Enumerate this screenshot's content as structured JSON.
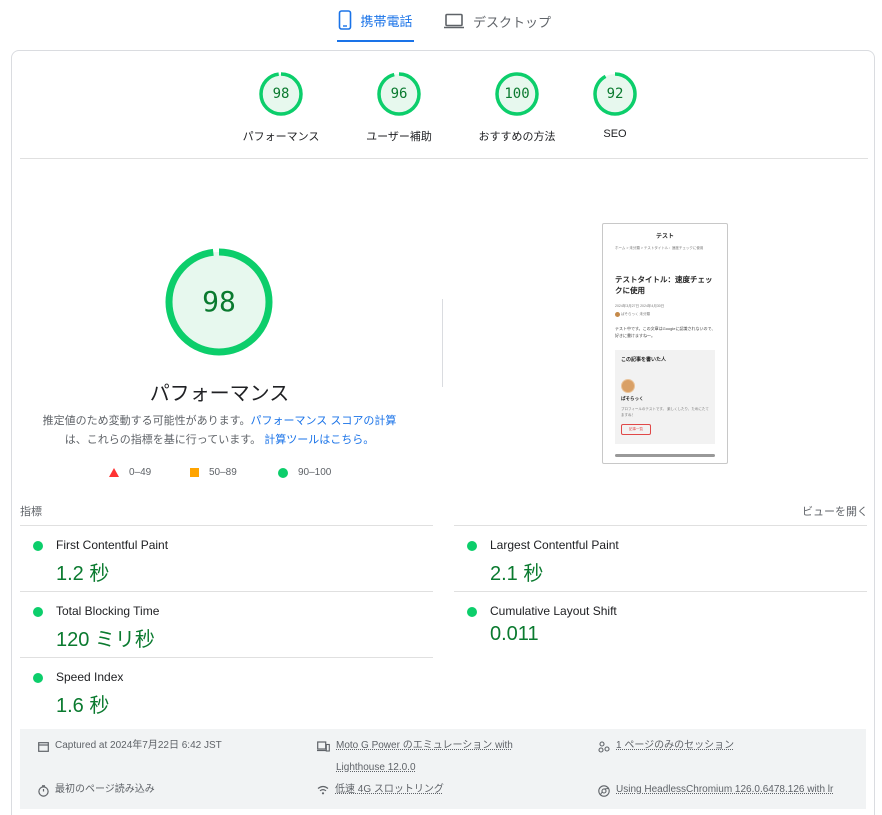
{
  "tabs": [
    {
      "label": "携帯電話",
      "icon": "smartphone-icon",
      "active": true
    },
    {
      "label": "デスクトップ",
      "icon": "laptop-icon",
      "active": false
    }
  ],
  "gauges": [
    {
      "score": "98",
      "label": "パフォーマンス"
    },
    {
      "score": "96",
      "label": "ユーザー補助"
    },
    {
      "score": "100",
      "label": "おすすめの方法"
    },
    {
      "score": "92",
      "label": "SEO"
    }
  ],
  "performance": {
    "score": "98",
    "title": "パフォーマンス",
    "desc_1": "推定値のため変動する可能性があります。",
    "link_1": "パフォーマンス スコアの計算",
    "desc_2": "は、これらの指標を基に行っています。",
    "link_2": "計算ツールはこちら。"
  },
  "legend": [
    {
      "range": "0–49",
      "color": "#ff3333",
      "shape": "triangle"
    },
    {
      "range": "50–89",
      "color": "#ffa400",
      "shape": "square"
    },
    {
      "range": "90–100",
      "color": "#0cce6b",
      "shape": "circle"
    }
  ],
  "screenshot": {
    "site_title": "テスト",
    "breadcrumb": "ホーム > 未分類 > テストタイトル：速度チェックに使用",
    "heading": "テストタイトル：速度チェックに使用",
    "meta": "2024年3月27日  2024年4月30日",
    "author_meta": "ぱそらっく  未分類",
    "body": "テスト中です。この文章はGoogleに認識されないので、好きに書けますね〜。",
    "box_title": "この記事を書いた人",
    "author_name": "ぱそらっく",
    "profile": "プロフィールのテストです。 楽しくしたり、ためにたてますね！",
    "button": "記事一覧"
  },
  "metrics": {
    "label": "指標",
    "expand_label": "ビューを開く",
    "items": [
      {
        "name": "First Contentful Paint",
        "value": "1.2 秒",
        "status_color": "#0cce6b"
      },
      {
        "name": "Largest Contentful Paint",
        "value": "2.1 秒",
        "status_color": "#0cce6b"
      },
      {
        "name": "Total Blocking Time",
        "value": "120 ミリ秒",
        "status_color": "#0cce6b"
      },
      {
        "name": "Cumulative Layout Shift",
        "value": "0.011",
        "status_color": "#0cce6b"
      },
      {
        "name": "Speed Index",
        "value": "1.6 秒",
        "status_color": "#0cce6b"
      }
    ]
  },
  "environment": {
    "captured": "Captured at 2024年7月22日 6:42 JST",
    "device_line1": "Moto G Power のエミュレーション with",
    "device_line2": "Lighthouse 12.0.0",
    "session": "1 ページのみのセッション",
    "initial_load": "最初のページ読み込み",
    "throttling": "低速 4G スロットリング",
    "browser": "Using HeadlessChromium 126.0.6478.126 with lr"
  },
  "colors": {
    "accent": "#1a73e8",
    "pass": "#0cce6b",
    "pass_text": "#0a7a2f",
    "average": "#ffa400",
    "fail": "#ff3333"
  }
}
